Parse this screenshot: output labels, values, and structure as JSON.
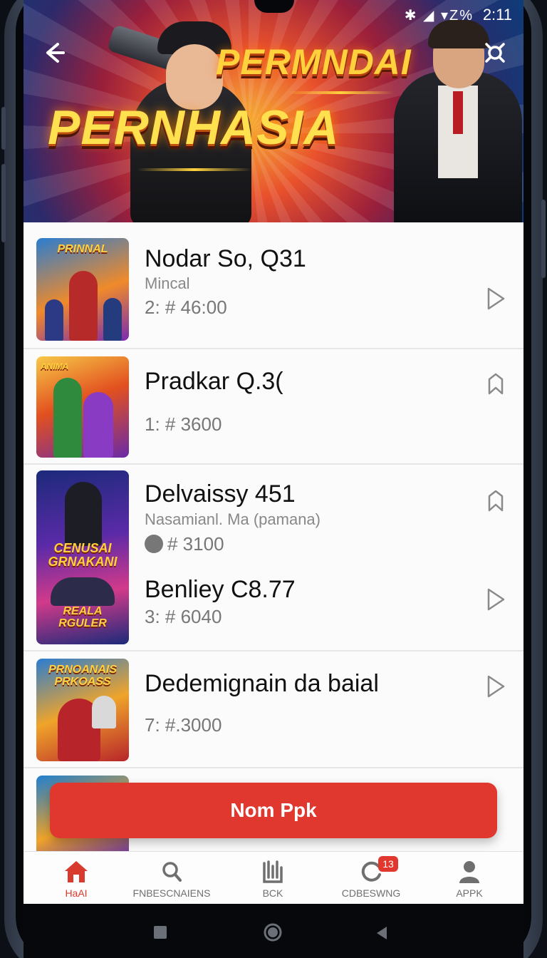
{
  "status_bar": {
    "icons_text": "✱ ◢ ▾Z%",
    "time": "2:11"
  },
  "banner": {
    "title_top": "PERMNDAI",
    "title_main": "PERNHASIA",
    "back_icon": "arrow-left-icon",
    "share_icon": "share-icon"
  },
  "list": {
    "items": [
      {
        "title": "Nodar So, Q31",
        "subtitle": "Mincal",
        "price": "2: # 46:00",
        "thumb_label": "PRINNAL",
        "action_icon": "play-triangle-icon"
      },
      {
        "title": "Pradkar Q.3(",
        "subtitle": "",
        "price": "1: # 3600",
        "thumb_label": "ANIMA",
        "action_icon": "bookmark-icon"
      },
      {
        "title": "Delvaissy 451",
        "subtitle": "Nasamianl. Ma (pamana)",
        "price": "# 3100",
        "thumb_label": "CENUSAI GRNAKANI",
        "thumb_label_2": "REALA RGULER",
        "action_icon": "bookmark-icon"
      },
      {
        "title": "Benliey C8.77",
        "subtitle": "",
        "price": "3: # 6040",
        "thumb_label": "",
        "action_icon": "play-triangle-icon"
      },
      {
        "title": "Dedemignain da baial",
        "subtitle": "",
        "price": "7: #.3000",
        "thumb_label": "PRNOANAIS PRKOASS",
        "action_icon": "play-triangle-icon"
      }
    ]
  },
  "cta": {
    "label": "Nom Ppk"
  },
  "bottom_nav": {
    "items": [
      {
        "label": "HaAI",
        "icon": "home-icon"
      },
      {
        "label": "FNBESCNAIENS",
        "icon": "search-icon"
      },
      {
        "label": "BCK",
        "icon": "book-icon"
      },
      {
        "label": "CDBESWNG",
        "icon": "refresh-icon",
        "badge": "13"
      },
      {
        "label": "APPK",
        "icon": "person-icon"
      }
    ]
  },
  "colors": {
    "accent": "#e0372e",
    "banner_gold": "#ffd23d"
  }
}
